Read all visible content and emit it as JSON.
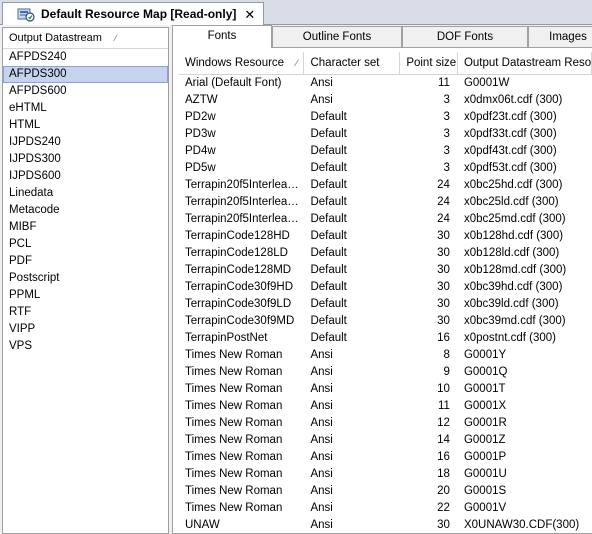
{
  "document_tab": {
    "title": "Default Resource Map [Read-only]",
    "close_label": "✕"
  },
  "left_panel": {
    "header": "Output Datastream",
    "items": [
      {
        "label": "AFPDS240",
        "selected": false
      },
      {
        "label": "AFPDS300",
        "selected": true
      },
      {
        "label": "AFPDS600",
        "selected": false
      },
      {
        "label": "eHTML",
        "selected": false
      },
      {
        "label": "HTML",
        "selected": false
      },
      {
        "label": "IJPDS240",
        "selected": false
      },
      {
        "label": "IJPDS300",
        "selected": false
      },
      {
        "label": "IJPDS600",
        "selected": false
      },
      {
        "label": "Linedata",
        "selected": false
      },
      {
        "label": "Metacode",
        "selected": false
      },
      {
        "label": "MIBF",
        "selected": false
      },
      {
        "label": "PCL",
        "selected": false
      },
      {
        "label": "PDF",
        "selected": false
      },
      {
        "label": "Postscript",
        "selected": false
      },
      {
        "label": "PPML",
        "selected": false
      },
      {
        "label": "RTF",
        "selected": false
      },
      {
        "label": "VIPP",
        "selected": false
      },
      {
        "label": "VPS",
        "selected": false
      }
    ]
  },
  "tabs": [
    {
      "label": "Fonts",
      "active": true
    },
    {
      "label": "Outline Fonts",
      "active": false
    },
    {
      "label": "DOF Fonts",
      "active": false
    },
    {
      "label": "Images",
      "active": false
    }
  ],
  "table": {
    "columns": [
      "Windows Resource",
      "Character set",
      "Point size",
      "Output Datastream Resource"
    ],
    "rows": [
      [
        "Arial  (Default Font)",
        "Ansi",
        "11",
        "G0001W"
      ],
      [
        "AZTW",
        "Ansi",
        "3",
        "x0dmx06t.cdf (300)"
      ],
      [
        "PD2w",
        "Default",
        "3",
        "x0pdf23t.cdf (300)"
      ],
      [
        "PD3w",
        "Default",
        "3",
        "x0pdf33t.cdf (300)"
      ],
      [
        "PD4w",
        "Default",
        "3",
        "x0pdf43t.cdf (300)"
      ],
      [
        "PD5w",
        "Default",
        "3",
        "x0pdf53t.cdf (300)"
      ],
      [
        "Terrapin20f5Interleave...",
        "Default",
        "24",
        "x0bc25hd.cdf (300)"
      ],
      [
        "Terrapin20f5Interleave...",
        "Default",
        "24",
        "x0bc25ld.cdf (300)"
      ],
      [
        "Terrapin20f5Interleave...",
        "Default",
        "24",
        "x0bc25md.cdf (300)"
      ],
      [
        "TerrapinCode128HD",
        "Default",
        "30",
        "x0b128hd.cdf (300)"
      ],
      [
        "TerrapinCode128LD",
        "Default",
        "30",
        "x0b128ld.cdf (300)"
      ],
      [
        "TerrapinCode128MD",
        "Default",
        "30",
        "x0b128md.cdf (300)"
      ],
      [
        "TerrapinCode30f9HD",
        "Default",
        "30",
        "x0bc39hd.cdf (300)"
      ],
      [
        "TerrapinCode30f9LD",
        "Default",
        "30",
        "x0bc39ld.cdf (300)"
      ],
      [
        "TerrapinCode30f9MD",
        "Default",
        "30",
        "x0bc39md.cdf (300)"
      ],
      [
        "TerrapinPostNet",
        "Default",
        "16",
        "x0postnt.cdf (300)"
      ],
      [
        "Times New Roman",
        "Ansi",
        "8",
        "G0001Y"
      ],
      [
        "Times New Roman",
        "Ansi",
        "9",
        "G0001Q"
      ],
      [
        "Times New Roman",
        "Ansi",
        "10",
        "G0001T"
      ],
      [
        "Times New Roman",
        "Ansi",
        "11",
        "G0001X"
      ],
      [
        "Times New Roman",
        "Ansi",
        "12",
        "G0001R"
      ],
      [
        "Times New Roman",
        "Ansi",
        "14",
        "G0001Z"
      ],
      [
        "Times New Roman",
        "Ansi",
        "16",
        "G0001P"
      ],
      [
        "Times New Roman",
        "Ansi",
        "18",
        "G0001U"
      ],
      [
        "Times New Roman",
        "Ansi",
        "20",
        "G0001S"
      ],
      [
        "Times New Roman",
        "Ansi",
        "22",
        "G0001V"
      ],
      [
        "UNAW",
        "Ansi",
        "30",
        "X0UNAW30.CDF(300)"
      ]
    ]
  }
}
